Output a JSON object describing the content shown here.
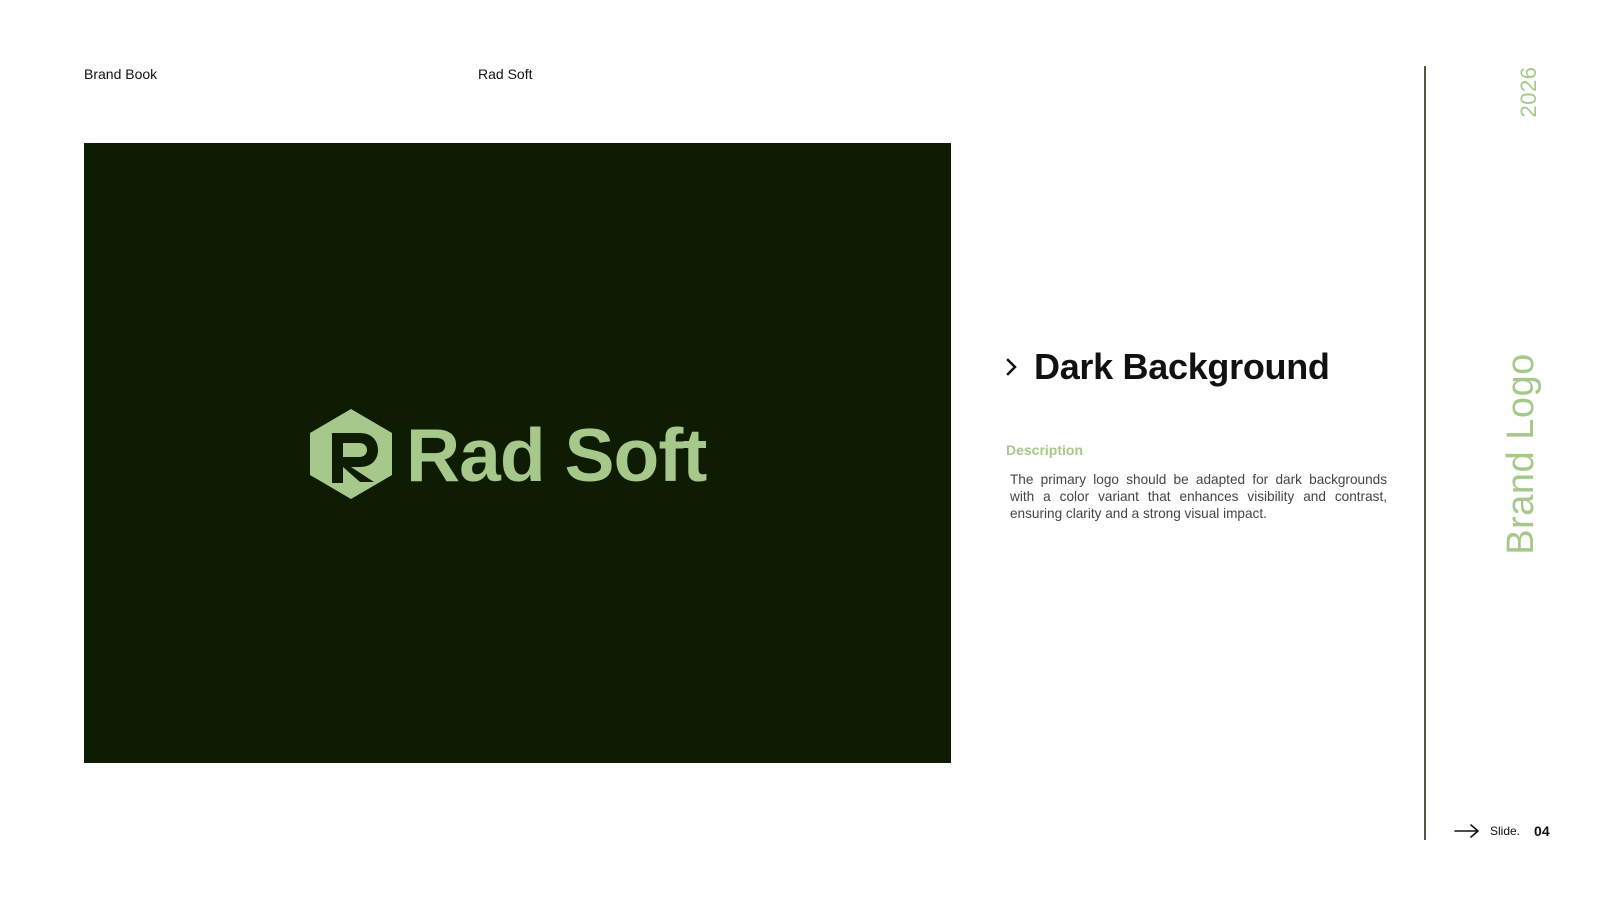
{
  "header": {
    "left_label": "Brand Book",
    "center_label": "Rad Soft"
  },
  "logo": {
    "wordmark": "Rad Soft",
    "mark_icon": "hexagon-r-icon",
    "background_color": "#0e1c04",
    "foreground_color": "#a6c98b"
  },
  "content": {
    "heading": "Dark Background",
    "heading_icon": "chevron-right-icon",
    "description_label": "Description",
    "description_text": "The primary logo should be adapted for dark backgrounds with a color variant that enhances visibility and contrast, ensuring clarity and a strong visual impact."
  },
  "sidebar": {
    "year": "2026",
    "section_title": "Brand Logo",
    "accent_color": "#a6c98b"
  },
  "footer": {
    "arrow_icon": "arrow-right-icon",
    "slide_label": "Slide.",
    "slide_number": "04"
  }
}
